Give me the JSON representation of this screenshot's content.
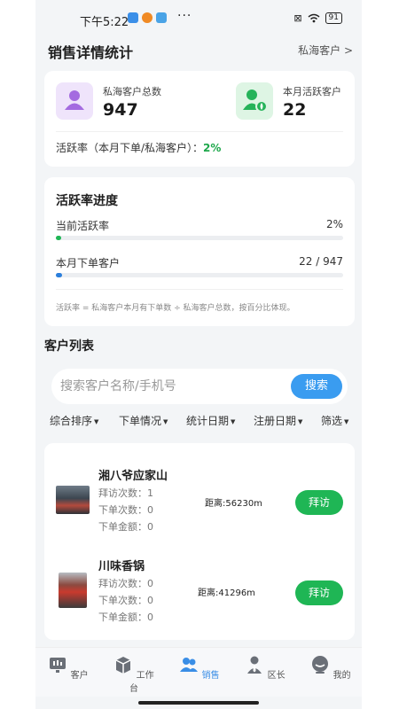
{
  "status_bar": {
    "time": "下午5:22",
    "battery": "91"
  },
  "header": {
    "title": "销售详情统计",
    "link": "私海客户 >"
  },
  "summary": {
    "total_label": "私海客户总数",
    "total_value": "947",
    "active_label": "本月活跃客户",
    "active_value": "22",
    "rate_label": "活跃率（本月下单/私海客户）：",
    "rate_value": "2%"
  },
  "progress": {
    "title": "活跃率进度",
    "current_label": "当前活跃率",
    "current_value": "2%",
    "current_fraction": 0.02,
    "orders_label": "本月下单客户",
    "orders_value": "22 / 947",
    "orders_fraction": 0.023,
    "note": "活跃率 = 私海客户本月有下单数 ÷ 私海客户总数，按百分比体现。"
  },
  "customer_list": {
    "title": "客户列表",
    "search_placeholder": "搜索客户名称/手机号",
    "search_button": "搜索",
    "filters": [
      "综合排序",
      "下单情况",
      "统计日期",
      "注册日期",
      "筛选"
    ],
    "items": [
      {
        "name": "湘八爷应家山",
        "visits": "拜访次数：1",
        "orders": "下单次数：0",
        "amount": "下单金额：0",
        "distance": "距离:56230m",
        "action": "拜访"
      },
      {
        "name": "川味香锅",
        "visits": "拜访次数：0",
        "orders": "下单次数：0",
        "amount": "下单金额：0",
        "distance": "距离:41296m",
        "action": "拜访"
      }
    ]
  },
  "tabbar": {
    "items": [
      {
        "label": "客户",
        "icon": "customer-icon"
      },
      {
        "label": "工作台",
        "icon": "workbench-icon"
      },
      {
        "label": "销售",
        "icon": "sales-icon"
      },
      {
        "label": "区长",
        "icon": "manager-icon"
      },
      {
        "label": "我的",
        "icon": "profile-icon"
      }
    ],
    "active": "销售"
  },
  "colors": {
    "accent": "#3a9cf0",
    "green": "#1fb655",
    "rate_green": "#1ea84b",
    "bg": "#f3f5f7"
  }
}
